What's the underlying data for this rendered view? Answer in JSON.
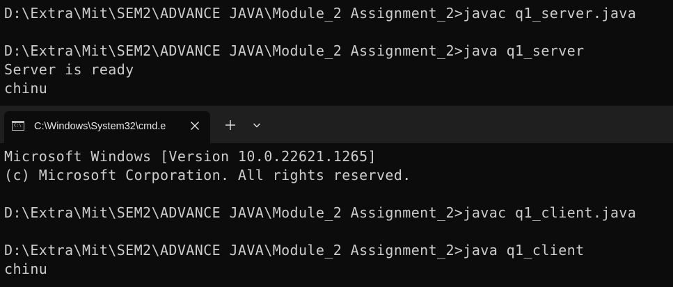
{
  "top_pane": {
    "lines": [
      "D:\\Extra\\Mit\\SEM2\\ADVANCE JAVA\\Module_2 Assignment_2>javac q1_server.java",
      "",
      "D:\\Extra\\Mit\\SEM2\\ADVANCE JAVA\\Module_2 Assignment_2>java q1_server",
      "Server is ready",
      "chinu"
    ]
  },
  "tabbar": {
    "active_tab": {
      "title": "C:\\Windows\\System32\\cmd.e",
      "icon": "cmd-icon"
    },
    "close_icon": "close-icon",
    "new_tab_icon": "plus-icon",
    "dropdown_icon": "chevron-down-icon"
  },
  "bottom_pane": {
    "lines": [
      "Microsoft Windows [Version 10.0.22621.1265]",
      "(c) Microsoft Corporation. All rights reserved.",
      "",
      "D:\\Extra\\Mit\\SEM2\\ADVANCE JAVA\\Module_2 Assignment_2>javac q1_client.java",
      "",
      "D:\\Extra\\Mit\\SEM2\\ADVANCE JAVA\\Module_2 Assignment_2>java q1_client",
      "chinu"
    ]
  },
  "colors": {
    "background": "#0c0c0c",
    "text": "#cccccc",
    "tabbar": "#1f1f1f"
  }
}
